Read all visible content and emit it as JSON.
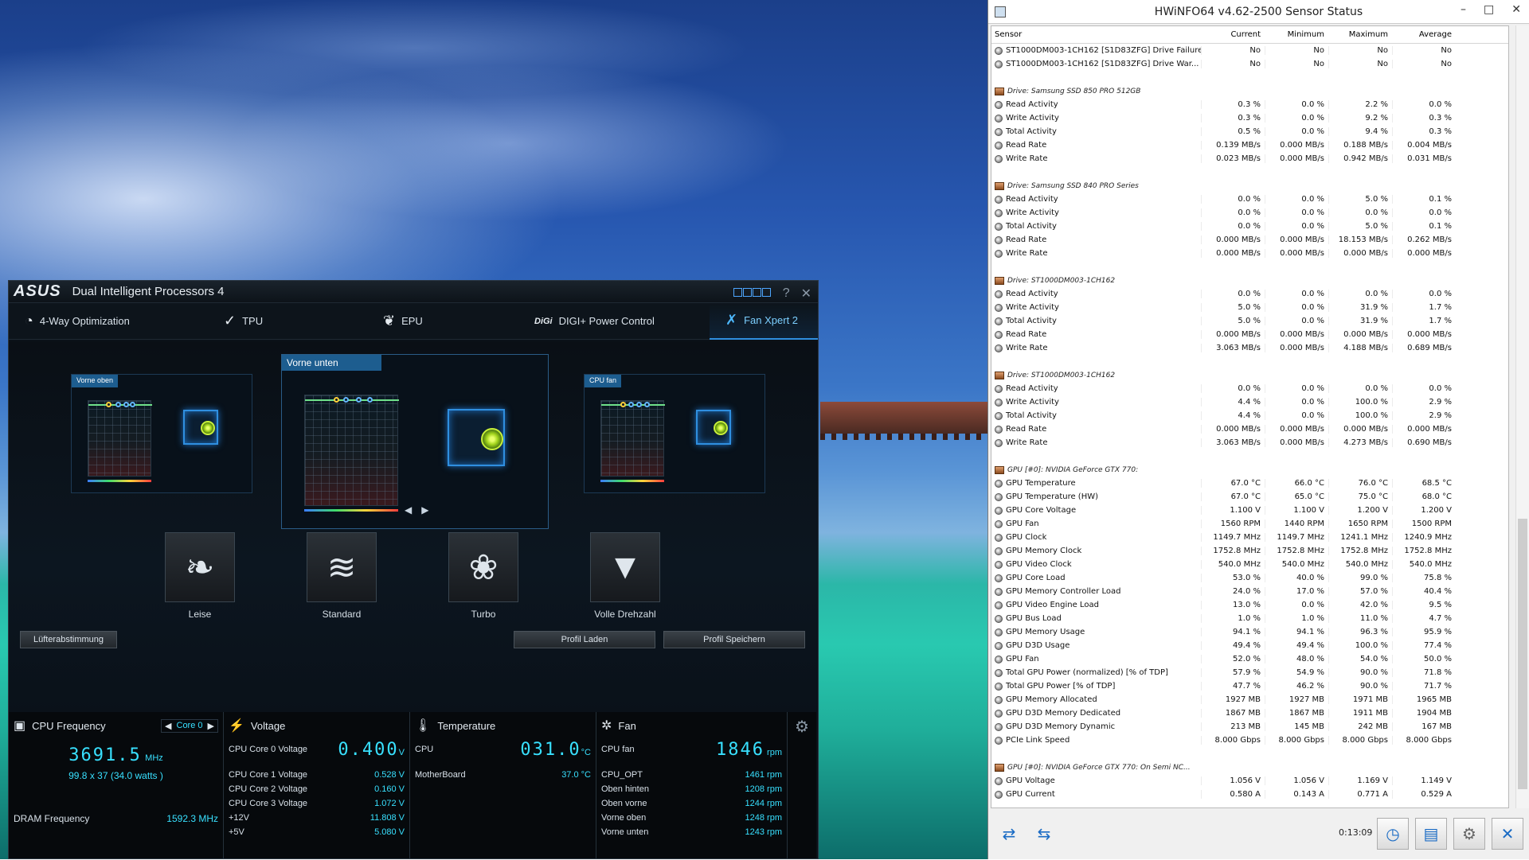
{
  "dip": {
    "logo": "ASUS",
    "title": "Dual Intelligent Processors 4",
    "ctrl_help": "?",
    "ctrl_close": "✕",
    "tabs": [
      {
        "label": "4-Way Optimization"
      },
      {
        "label": "TPU"
      },
      {
        "label": "EPU"
      },
      {
        "label": "DIGI+ Power Control"
      },
      {
        "label": "Fan Xpert 2"
      }
    ],
    "panels": {
      "left": "Vorne oben",
      "center": "Vorne unten",
      "right": "CPU fan"
    },
    "modes": [
      {
        "label": "Leise"
      },
      {
        "label": "Standard"
      },
      {
        "label": "Turbo"
      },
      {
        "label": "Volle Drehzahl"
      }
    ],
    "buttons": {
      "tuning": "Lüfterabstimmung",
      "load": "Profil Laden",
      "save": "Profil Speichern"
    },
    "cpu": {
      "title": "CPU Frequency",
      "core_selector": "Core 0",
      "freq": "3691.5",
      "freq_unit": "MHz",
      "detail": "99.8 x 37 (34.0  watts )",
      "dram_label": "DRAM Frequency",
      "dram_value": "1592.3  MHz"
    },
    "voltage": {
      "title": "Voltage",
      "main_label": "CPU Core 0 Voltage",
      "main_value": "0.400",
      "main_unit": "V",
      "rows": [
        {
          "label": "CPU Core 1 Voltage",
          "value": "0.528  V"
        },
        {
          "label": "CPU Core 2 Voltage",
          "value": "0.160  V"
        },
        {
          "label": "CPU Core 3 Voltage",
          "value": "1.072  V"
        },
        {
          "label": "+12V",
          "value": "11.808  V"
        },
        {
          "label": "+5V",
          "value": "5.080  V"
        }
      ]
    },
    "temperature": {
      "title": "Temperature",
      "main_label": "CPU",
      "main_value": "031.0",
      "main_unit": "°C",
      "rows": [
        {
          "label": "MotherBoard",
          "value": "37.0 °C"
        }
      ]
    },
    "fan": {
      "title": "Fan",
      "main_label": "CPU fan",
      "main_value": "1846",
      "main_unit": "rpm",
      "rows": [
        {
          "label": "CPU_OPT",
          "value": "1461  rpm"
        },
        {
          "label": "Oben hinten",
          "value": "1208  rpm"
        },
        {
          "label": "Oben vorne",
          "value": "1244  rpm"
        },
        {
          "label": "Vorne oben",
          "value": "1248  rpm"
        },
        {
          "label": "Vorne unten",
          "value": "1243  rpm"
        }
      ]
    }
  },
  "hw": {
    "title": "HWiNFO64 v4.62-2500 Sensor Status",
    "columns": [
      "Sensor",
      "Current",
      "Minimum",
      "Maximum",
      "Average"
    ],
    "timer": "0:13:09",
    "rows": [
      {
        "t": "r",
        "n": "ST1000DM003-1CH162 [S1D83ZFG] Drive Failure",
        "v": [
          "No",
          "No",
          "No",
          "No"
        ]
      },
      {
        "t": "r",
        "n": "ST1000DM003-1CH162 [S1D83ZFG] Drive War...",
        "v": [
          "No",
          "No",
          "No",
          "No"
        ]
      },
      {
        "t": "s"
      },
      {
        "t": "g",
        "n": "Drive: Samsung SSD 850 PRO 512GB"
      },
      {
        "t": "r",
        "n": "Read Activity",
        "v": [
          "0.3 %",
          "0.0 %",
          "2.2 %",
          "0.0 %"
        ]
      },
      {
        "t": "r",
        "n": "Write Activity",
        "v": [
          "0.3 %",
          "0.0 %",
          "9.2 %",
          "0.3 %"
        ]
      },
      {
        "t": "r",
        "n": "Total Activity",
        "v": [
          "0.5 %",
          "0.0 %",
          "9.4 %",
          "0.3 %"
        ]
      },
      {
        "t": "r",
        "n": "Read Rate",
        "v": [
          "0.139 MB/s",
          "0.000 MB/s",
          "0.188 MB/s",
          "0.004 MB/s"
        ]
      },
      {
        "t": "r",
        "n": "Write Rate",
        "v": [
          "0.023 MB/s",
          "0.000 MB/s",
          "0.942 MB/s",
          "0.031 MB/s"
        ]
      },
      {
        "t": "s"
      },
      {
        "t": "g",
        "n": "Drive: Samsung SSD 840 PRO Series"
      },
      {
        "t": "r",
        "n": "Read Activity",
        "v": [
          "0.0 %",
          "0.0 %",
          "5.0 %",
          "0.1 %"
        ]
      },
      {
        "t": "r",
        "n": "Write Activity",
        "v": [
          "0.0 %",
          "0.0 %",
          "0.0 %",
          "0.0 %"
        ]
      },
      {
        "t": "r",
        "n": "Total Activity",
        "v": [
          "0.0 %",
          "0.0 %",
          "5.0 %",
          "0.1 %"
        ]
      },
      {
        "t": "r",
        "n": "Read Rate",
        "v": [
          "0.000 MB/s",
          "0.000 MB/s",
          "18.153 MB/s",
          "0.262 MB/s"
        ]
      },
      {
        "t": "r",
        "n": "Write Rate",
        "v": [
          "0.000 MB/s",
          "0.000 MB/s",
          "0.000 MB/s",
          "0.000 MB/s"
        ]
      },
      {
        "t": "s"
      },
      {
        "t": "g",
        "n": "Drive: ST1000DM003-1CH162"
      },
      {
        "t": "r",
        "n": "Read Activity",
        "v": [
          "0.0 %",
          "0.0 %",
          "0.0 %",
          "0.0 %"
        ]
      },
      {
        "t": "r",
        "n": "Write Activity",
        "v": [
          "5.0 %",
          "0.0 %",
          "31.9 %",
          "1.7 %"
        ]
      },
      {
        "t": "r",
        "n": "Total Activity",
        "v": [
          "5.0 %",
          "0.0 %",
          "31.9 %",
          "1.7 %"
        ]
      },
      {
        "t": "r",
        "n": "Read Rate",
        "v": [
          "0.000 MB/s",
          "0.000 MB/s",
          "0.000 MB/s",
          "0.000 MB/s"
        ]
      },
      {
        "t": "r",
        "n": "Write Rate",
        "v": [
          "3.063 MB/s",
          "0.000 MB/s",
          "4.188 MB/s",
          "0.689 MB/s"
        ]
      },
      {
        "t": "s"
      },
      {
        "t": "g",
        "n": "Drive: ST1000DM003-1CH162"
      },
      {
        "t": "r",
        "n": "Read Activity",
        "v": [
          "0.0 %",
          "0.0 %",
          "0.0 %",
          "0.0 %"
        ]
      },
      {
        "t": "r",
        "n": "Write Activity",
        "v": [
          "4.4 %",
          "0.0 %",
          "100.0 %",
          "2.9 %"
        ]
      },
      {
        "t": "r",
        "n": "Total Activity",
        "v": [
          "4.4 %",
          "0.0 %",
          "100.0 %",
          "2.9 %"
        ]
      },
      {
        "t": "r",
        "n": "Read Rate",
        "v": [
          "0.000 MB/s",
          "0.000 MB/s",
          "0.000 MB/s",
          "0.000 MB/s"
        ]
      },
      {
        "t": "r",
        "n": "Write Rate",
        "v": [
          "3.063 MB/s",
          "0.000 MB/s",
          "4.273 MB/s",
          "0.690 MB/s"
        ]
      },
      {
        "t": "s"
      },
      {
        "t": "g",
        "n": "GPU [#0]: NVIDIA GeForce GTX 770:"
      },
      {
        "t": "r",
        "n": "GPU Temperature",
        "v": [
          "67.0 °C",
          "66.0 °C",
          "76.0 °C",
          "68.5 °C"
        ]
      },
      {
        "t": "r",
        "n": "GPU Temperature (HW)",
        "v": [
          "67.0 °C",
          "65.0 °C",
          "75.0 °C",
          "68.0 °C"
        ]
      },
      {
        "t": "r",
        "n": "GPU Core Voltage",
        "v": [
          "1.100 V",
          "1.100 V",
          "1.200 V",
          "1.200 V"
        ]
      },
      {
        "t": "r",
        "n": "GPU Fan",
        "v": [
          "1560 RPM",
          "1440 RPM",
          "1650 RPM",
          "1500 RPM"
        ]
      },
      {
        "t": "r",
        "n": "GPU Clock",
        "v": [
          "1149.7 MHz",
          "1149.7 MHz",
          "1241.1 MHz",
          "1240.9 MHz"
        ]
      },
      {
        "t": "r",
        "n": "GPU Memory Clock",
        "v": [
          "1752.8 MHz",
          "1752.8 MHz",
          "1752.8 MHz",
          "1752.8 MHz"
        ]
      },
      {
        "t": "r",
        "n": "GPU Video Clock",
        "v": [
          "540.0 MHz",
          "540.0 MHz",
          "540.0 MHz",
          "540.0 MHz"
        ]
      },
      {
        "t": "r",
        "n": "GPU Core Load",
        "v": [
          "53.0 %",
          "40.0 %",
          "99.0 %",
          "75.8 %"
        ]
      },
      {
        "t": "r",
        "n": "GPU Memory Controller Load",
        "v": [
          "24.0 %",
          "17.0 %",
          "57.0 %",
          "40.4 %"
        ]
      },
      {
        "t": "r",
        "n": "GPU Video Engine Load",
        "v": [
          "13.0 %",
          "0.0 %",
          "42.0 %",
          "9.5 %"
        ]
      },
      {
        "t": "r",
        "n": "GPU Bus Load",
        "v": [
          "1.0 %",
          "1.0 %",
          "11.0 %",
          "4.7 %"
        ]
      },
      {
        "t": "r",
        "n": "GPU Memory Usage",
        "v": [
          "94.1 %",
          "94.1 %",
          "96.3 %",
          "95.9 %"
        ]
      },
      {
        "t": "r",
        "n": "GPU D3D Usage",
        "v": [
          "49.4 %",
          "49.4 %",
          "100.0 %",
          "77.4 %"
        ]
      },
      {
        "t": "r",
        "n": "GPU Fan",
        "v": [
          "52.0 %",
          "48.0 %",
          "54.0 %",
          "50.0 %"
        ]
      },
      {
        "t": "r",
        "n": "Total GPU Power (normalized) [% of TDP]",
        "v": [
          "57.9 %",
          "54.9 %",
          "90.0 %",
          "71.8 %"
        ]
      },
      {
        "t": "r",
        "n": "Total GPU Power [% of TDP]",
        "v": [
          "47.7 %",
          "46.2 %",
          "90.0 %",
          "71.7 %"
        ]
      },
      {
        "t": "r",
        "n": "GPU Memory Allocated",
        "v": [
          "1927 MB",
          "1927 MB",
          "1971 MB",
          "1965 MB"
        ]
      },
      {
        "t": "r",
        "n": "GPU D3D Memory Dedicated",
        "v": [
          "1867 MB",
          "1867 MB",
          "1911 MB",
          "1904 MB"
        ]
      },
      {
        "t": "r",
        "n": "GPU D3D Memory Dynamic",
        "v": [
          "213 MB",
          "145 MB",
          "242 MB",
          "167 MB"
        ]
      },
      {
        "t": "r",
        "n": "PCIe Link Speed",
        "v": [
          "8.000 Gbps",
          "8.000 Gbps",
          "8.000 Gbps",
          "8.000 Gbps"
        ]
      },
      {
        "t": "s"
      },
      {
        "t": "g",
        "n": "GPU [#0]: NVIDIA GeForce GTX 770: On Semi NC..."
      },
      {
        "t": "r",
        "n": "GPU Voltage",
        "v": [
          "1.056 V",
          "1.056 V",
          "1.169 V",
          "1.149 V"
        ]
      },
      {
        "t": "r",
        "n": "GPU Current",
        "v": [
          "0.580 A",
          "0.143 A",
          "0.771 A",
          "0.529 A"
        ]
      }
    ]
  }
}
